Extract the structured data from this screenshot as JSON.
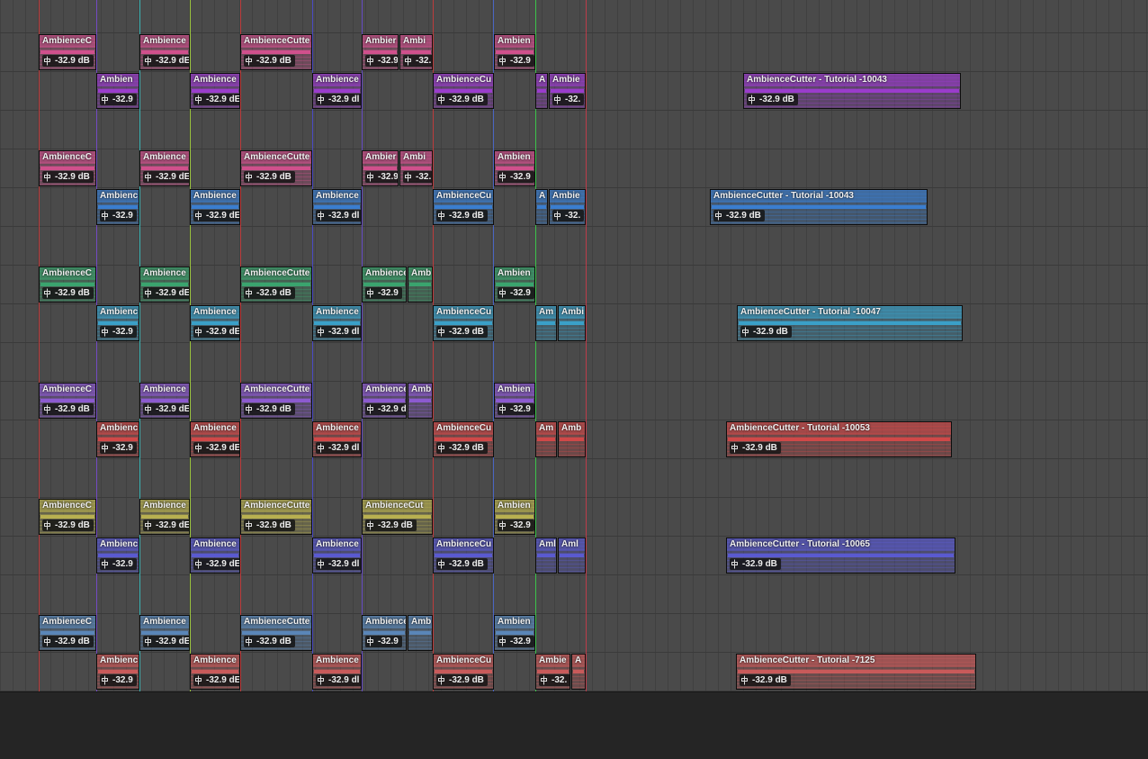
{
  "colors": {
    "pink": "#d0508c",
    "purple": "#9a3ccc",
    "blue": "#3a7ed0",
    "green": "#3aa46e",
    "cyan": "#3aa0c8",
    "violet": "#8c5ad0",
    "red": "#d04848",
    "olive": "#b8b050",
    "indigo": "#5a5ad0",
    "steel": "#5a86b8",
    "rose": "#c85a5a",
    "markers": [
      "#d03a3a",
      "#7a4ad8",
      "#3ac8c8",
      "#a8d83a",
      "#d03a3a",
      "#4a4ad8",
      "#6a4ad8",
      "#d03a3a",
      "#4a6ad8",
      "#3ad84a",
      "#d03a4a"
    ]
  },
  "icons": {
    "volume_handle": "volume-fader-icon"
  },
  "lanes": [
    {
      "color": "pink",
      "clips": [
        {
          "label": "AmbienceC",
          "volume": "-32.9 dB"
        },
        {
          "label": "Ambience",
          "volume": "-32.9 dE"
        },
        {
          "label": "AmbienceCutte",
          "volume": "-32.9 dB"
        },
        {
          "label": "Ambier",
          "volume": "-32.9"
        },
        {
          "label": "Ambi",
          "volume": "-32."
        },
        {
          "label": "Ambien",
          "volume": "-32.9"
        }
      ]
    },
    {
      "color": "purple",
      "clips": [
        {
          "label": "Ambien",
          "volume": "-32.9"
        },
        {
          "label": "Ambience",
          "volume": "-32.9 dE"
        },
        {
          "label": "Ambience",
          "volume": "-32.9 dl"
        },
        {
          "label": "AmbienceCu",
          "volume": "-32.9 dB"
        },
        {
          "label": "A",
          "volume": ""
        },
        {
          "label": "Ambie",
          "volume": "-32."
        },
        {
          "label": "AmbienceCutter - Tutorial -10043",
          "volume": "-32.9 dB"
        }
      ]
    },
    {
      "color": "",
      "clips": []
    },
    {
      "color": "pink",
      "clips": [
        {
          "label": "AmbienceC",
          "volume": "-32.9 dB"
        },
        {
          "label": "Ambience",
          "volume": "-32.9 dE"
        },
        {
          "label": "AmbienceCutte",
          "volume": "-32.9 dB"
        },
        {
          "label": "Ambier",
          "volume": "-32.9"
        },
        {
          "label": "Ambi",
          "volume": "-32."
        },
        {
          "label": "Ambien",
          "volume": "-32.9"
        }
      ]
    },
    {
      "color": "blue",
      "clips": [
        {
          "label": "Ambienc",
          "volume": "-32.9"
        },
        {
          "label": "Ambience",
          "volume": "-32.9 dE"
        },
        {
          "label": "Ambience",
          "volume": "-32.9 dl"
        },
        {
          "label": "AmbienceCu",
          "volume": "-32.9 dB"
        },
        {
          "label": "A",
          "volume": ""
        },
        {
          "label": "Ambie",
          "volume": "-32."
        },
        {
          "label": "AmbienceCutter - Tutorial -10043",
          "volume": "-32.9 dB"
        }
      ]
    },
    {
      "color": "",
      "clips": []
    },
    {
      "color": "green",
      "clips": [
        {
          "label": "AmbienceC",
          "volume": "-32.9 dB"
        },
        {
          "label": "Ambience",
          "volume": "-32.9 dE"
        },
        {
          "label": "AmbienceCutte",
          "volume": "-32.9 dB"
        },
        {
          "label": "Ambience",
          "volume": "-32.9"
        },
        {
          "label": "Amb",
          "volume": ""
        },
        {
          "label": "Ambien",
          "volume": "-32.9"
        }
      ]
    },
    {
      "color": "cyan",
      "clips": [
        {
          "label": "Ambienc",
          "volume": "-32.9"
        },
        {
          "label": "Ambience",
          "volume": "-32.9 dE"
        },
        {
          "label": "Ambience",
          "volume": "-32.9 dl"
        },
        {
          "label": "AmbienceCu",
          "volume": "-32.9 dB"
        },
        {
          "label": "Am",
          "volume": ""
        },
        {
          "label": "Ambi",
          "volume": ""
        },
        {
          "label": "AmbienceCutter - Tutorial -10047",
          "volume": "-32.9 dB"
        }
      ]
    },
    {
      "color": "",
      "clips": []
    },
    {
      "color": "violet",
      "clips": [
        {
          "label": "AmbienceC",
          "volume": "-32.9 dB"
        },
        {
          "label": "Ambience",
          "volume": "-32.9 dE"
        },
        {
          "label": "AmbienceCutte",
          "volume": "-32.9 dB"
        },
        {
          "label": "Ambience",
          "volume": "-32.9 d"
        },
        {
          "label": "Amb",
          "volume": ""
        },
        {
          "label": "Ambien",
          "volume": "-32.9"
        }
      ]
    },
    {
      "color": "red",
      "clips": [
        {
          "label": "Ambienc",
          "volume": "-32.9"
        },
        {
          "label": "Ambience",
          "volume": "-32.9 dE"
        },
        {
          "label": "Ambience",
          "volume": "-32.9 dl"
        },
        {
          "label": "AmbienceCu",
          "volume": "-32.9 dB"
        },
        {
          "label": "Am",
          "volume": ""
        },
        {
          "label": "Amb",
          "volume": ""
        },
        {
          "label": "AmbienceCutter - Tutorial -10053",
          "volume": "-32.9 dB"
        }
      ]
    },
    {
      "color": "",
      "clips": []
    },
    {
      "color": "olive",
      "clips": [
        {
          "label": "AmbienceC",
          "volume": "-32.9 dB"
        },
        {
          "label": "Ambience",
          "volume": "-32.9 dE"
        },
        {
          "label": "AmbienceCutte",
          "volume": "-32.9 dB"
        },
        {
          "label": "AmbienceCut",
          "volume": "-32.9 dB"
        },
        {
          "label": "Ambien",
          "volume": "-32.9"
        }
      ]
    },
    {
      "color": "indigo",
      "clips": [
        {
          "label": "Ambienc",
          "volume": "-32.9"
        },
        {
          "label": "Ambience",
          "volume": "-32.9 dE"
        },
        {
          "label": "Ambience",
          "volume": "-32.9 dl"
        },
        {
          "label": "AmbienceCu",
          "volume": "-32.9 dB"
        },
        {
          "label": "Aml",
          "volume": ""
        },
        {
          "label": "Aml",
          "volume": ""
        },
        {
          "label": "AmbienceCutter - Tutorial -10065",
          "volume": "-32.9 dB"
        }
      ]
    },
    {
      "color": "",
      "clips": []
    },
    {
      "color": "steel",
      "clips": [
        {
          "label": "AmbienceC",
          "volume": "-32.9 dB"
        },
        {
          "label": "Ambience",
          "volume": "-32.9 dE"
        },
        {
          "label": "AmbienceCutte",
          "volume": "-32.9 dB"
        },
        {
          "label": "Ambience",
          "volume": "-32.9"
        },
        {
          "label": "Amb",
          "volume": ""
        },
        {
          "label": "Ambien",
          "volume": "-32.9"
        }
      ]
    },
    {
      "color": "rose",
      "clips": [
        {
          "label": "Ambienc",
          "volume": "-32.9"
        },
        {
          "label": "Ambience",
          "volume": "-32.9 dE"
        },
        {
          "label": "Ambience",
          "volume": "-32.9 dl"
        },
        {
          "label": "AmbienceCu",
          "volume": "-32.9 dB"
        },
        {
          "label": "Ambie",
          "volume": "-32."
        },
        {
          "label": "A",
          "volume": ""
        },
        {
          "label": "AmbienceCutter - Tutorial -7125",
          "volume": "-32.9 dB"
        }
      ]
    }
  ]
}
